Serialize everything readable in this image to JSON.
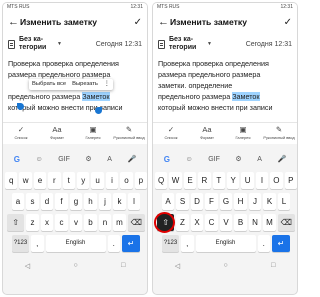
{
  "status": {
    "left": "MTS RUS",
    "right": "12:31"
  },
  "appbar": {
    "back": "←",
    "title": "Изменить заметку",
    "confirm": "✓"
  },
  "meta": {
    "category": "Без ка-тегории",
    "dropdown": "▼",
    "date": "Сегодня 12:31"
  },
  "note": {
    "lines": [
      "Проверка проверка определения",
      "размера предельного размера",
      "заметки. определение",
      "предельного размера ",
      "который можно внести при записи"
    ],
    "selected": "Заметок",
    "context_menu": {
      "select_all": "Выбрать все",
      "cut": "Вырезать",
      "more": "⋮"
    }
  },
  "toolbar": {
    "items": [
      {
        "icon": "✓",
        "label": "Список"
      },
      {
        "icon": "Aa",
        "label": "Формат"
      },
      {
        "icon": "▣",
        "label": "Галерея"
      },
      {
        "icon": "✎",
        "label": "Рукописный ввод"
      }
    ]
  },
  "keyboard": {
    "suggestions": [
      "G",
      "☺",
      "GIF",
      "⚙",
      "A",
      "🎤"
    ],
    "row1": [
      "q",
      "w",
      "e",
      "r",
      "t",
      "y",
      "u",
      "i",
      "o",
      "p"
    ],
    "row2": [
      "a",
      "s",
      "d",
      "f",
      "g",
      "h",
      "j",
      "k",
      "l"
    ],
    "row3_left": [
      "z",
      "x",
      "c",
      "v",
      "b",
      "n",
      "m"
    ],
    "row3_right": [
      "Z",
      "X",
      "C",
      "V",
      "B",
      "N",
      "M"
    ],
    "row2_right": [
      "A",
      "S",
      "D",
      "F",
      "G",
      "H",
      "J",
      "K",
      "L"
    ],
    "row1_right": [
      "Q",
      "W",
      "E",
      "R",
      "T",
      "Y",
      "U",
      "I",
      "O",
      "P"
    ],
    "shift": "⇧",
    "backspace": "⌫",
    "num": "?123",
    "comma": ",",
    "space": "English",
    "period": ".",
    "enter": "↵"
  },
  "nav": {
    "back": "◁",
    "home": "○",
    "recent": "□"
  }
}
